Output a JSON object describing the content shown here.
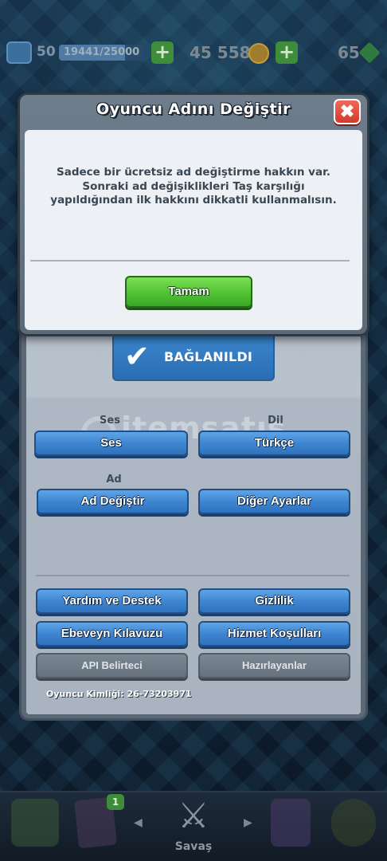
{
  "hud": {
    "level": "50",
    "xp_text": "19441/25000",
    "xp_progress": 0.78,
    "gold": "45 558",
    "gems": "65"
  },
  "dialog": {
    "title": "Oyuncu Adını Değiştir",
    "close_label": "✖",
    "message": "Sadece bir ücretsiz ad değiştirme hakkın var. Sonraki ad değişiklikleri Taş karşılığı yapıldığından ilk hakkını dikkatli kullanmalısın.",
    "ok_label": "Tamam"
  },
  "settings": {
    "connected_label": "BAĞLANILDI",
    "sound_section": "Ses",
    "sound_button": "Ses",
    "language_section": "Dil",
    "language_button": "Türkçe",
    "name_section": "Ad",
    "name_button": "Ad Değiştir",
    "other_settings_button": "Diğer Ayarlar",
    "help_button": "Yardım ve Destek",
    "privacy_button": "Gizlilik",
    "parent_guide_button": "Ebeveyn Kılavuzu",
    "terms_button": "Hizmet Koşulları",
    "api_button": "API Belirteci",
    "credits_button": "Hazırlayanlar",
    "player_id": "Oyuncu Kimliği: 26-73203971",
    "watermark": "itemsatış"
  },
  "nav": {
    "cards_badge": "1",
    "battle_label": "Savaş"
  },
  "colors": {
    "ok_green": "#4fc234",
    "button_blue": "#3f86d2",
    "close_red": "#d4392a"
  }
}
